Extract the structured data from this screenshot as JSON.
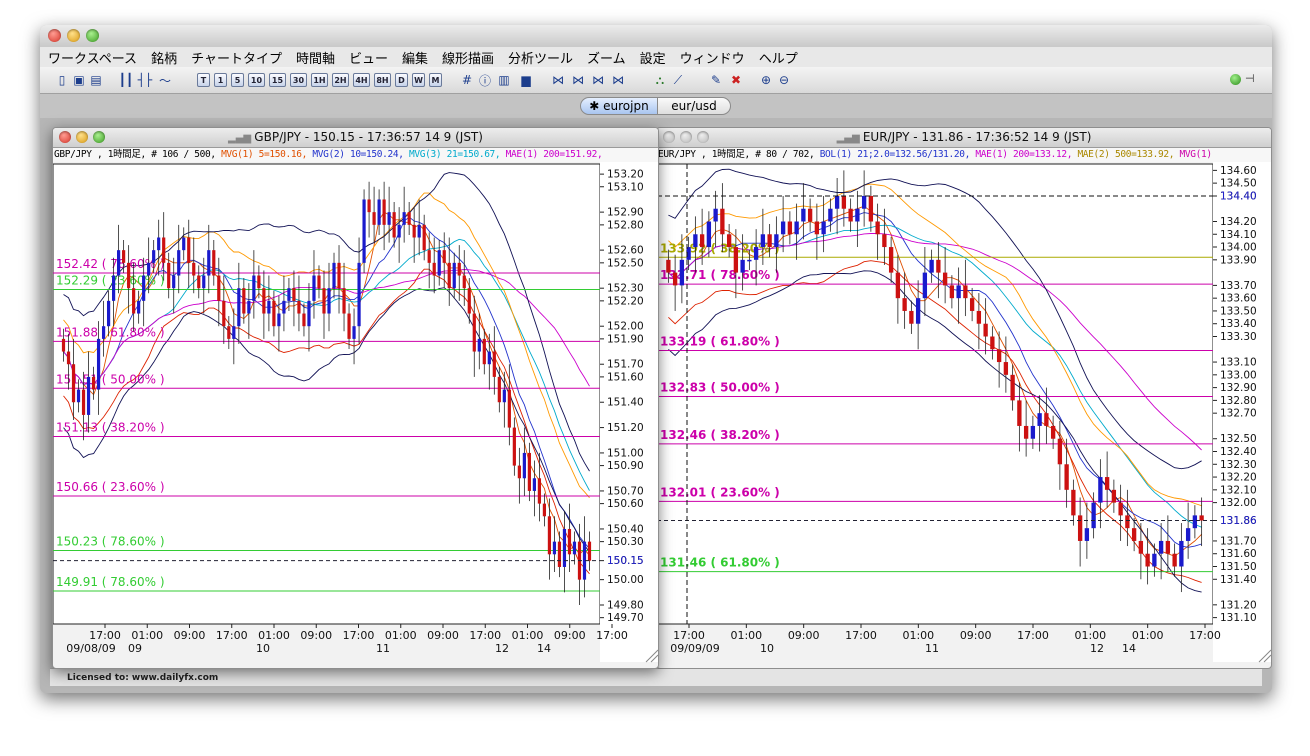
{
  "app": {
    "menus": [
      "ワークスペース",
      "銘柄",
      "チャートタイプ",
      "時間軸",
      "ビュー",
      "編集",
      "線形描画",
      "分析ツール",
      "ズーム",
      "設定",
      "ウィンドウ",
      "ヘルプ"
    ],
    "toolbar_timeframes": [
      "T",
      "1",
      "5",
      "10",
      "15",
      "30",
      "1H",
      "2H",
      "4H",
      "8H",
      "D",
      "W",
      "M"
    ],
    "toolbar_icons": [
      "new-chart-icon",
      "save-icon",
      "print-icon",
      "candle-chart-icon",
      "bar-chart-icon",
      "line-chart-icon",
      "grid-icon",
      "info-icon",
      "volume-icon",
      "bars-inactive-icon",
      "draw-tool-1-icon",
      "draw-tool-2-icon",
      "draw-tool-3-icon",
      "draw-tool-4-icon",
      "indicator-icon",
      "trend-line-icon",
      "eraser-icon",
      "delete-icon",
      "zoom-in-icon",
      "zoom-out-icon"
    ],
    "tabs": [
      {
        "label": "✱ eurojpn",
        "active": true
      },
      {
        "label": "eur/usd",
        "active": false
      }
    ],
    "status_text": "Licensed to: www.dailyfx.com",
    "colors": {
      "candle_up": "#1a1acc",
      "candle_down": "#cc1111",
      "fib": "#cc00aa",
      "fib_green": "#33cc33",
      "price_marker": "#2222cc"
    }
  },
  "charts": [
    {
      "title": "GBP/JPY - 150.15 - 17:36:57  14 9 (JST)",
      "info": [
        {
          "text": "GBP/JPY , 1時間足, # 106 / 500, ",
          "color": "#000000"
        },
        {
          "text": "MVG(1) 5=150.16, ",
          "color": "#e05000"
        },
        {
          "text": "MVG(2) 10=150.24, ",
          "color": "#2233cc"
        },
        {
          "text": "MVG(3) 21=150.67, ",
          "color": "#00aacc"
        },
        {
          "text": "MAE(1) 200=151.92, ",
          "color": "#cc00cc"
        }
      ],
      "fib_labels": [
        "152.42 ( 78.60% )",
        "152.29 ( 23.60% )",
        "151.88 ( 61.80% )",
        "151.51 ( 50.00% )",
        "151.13 ( 38.20% )",
        "150.66 ( 23.60% )",
        "150.23 ( 78.60% )",
        "149.91 ( 78.60% )"
      ],
      "current_price": "150.15",
      "xtick_times": [
        "17:00",
        "01:00",
        "09:00",
        "17:00",
        "01:00",
        "09:00",
        "17:00",
        "01:00",
        "09:00",
        "17:00",
        "01:00",
        "09:00",
        "17:00"
      ],
      "xtick_dates": [
        "09/08/09",
        "09",
        "10",
        "11",
        "12",
        "14"
      ],
      "chart_data": {
        "type": "candlestick",
        "y_ticks": [
          153.2,
          153.1,
          152.9,
          152.8,
          152.6,
          152.5,
          152.3,
          152.2,
          152.0,
          151.9,
          151.7,
          151.6,
          151.4,
          151.2,
          151.0,
          150.9,
          150.7,
          150.6,
          150.4,
          150.3,
          150.15,
          150.0,
          149.8,
          149.7
        ],
        "ylim": [
          149.65,
          153.28
        ],
        "fib_levels": [
          {
            "value": 152.42,
            "color": "#cc00aa"
          },
          {
            "value": 152.29,
            "color": "#33cc33"
          },
          {
            "value": 151.88,
            "color": "#cc00aa"
          },
          {
            "value": 151.51,
            "color": "#cc00aa"
          },
          {
            "value": 151.13,
            "color": "#cc00aa"
          },
          {
            "value": 150.66,
            "color": "#cc00aa"
          },
          {
            "value": 150.23,
            "color": "#33cc33"
          },
          {
            "value": 149.91,
            "color": "#33cc33"
          }
        ],
        "current_price": 150.15,
        "closes": [
          151.8,
          151.7,
          151.4,
          151.5,
          151.3,
          151.6,
          151.5,
          151.9,
          152.0,
          152.2,
          152.4,
          152.6,
          152.5,
          152.3,
          152.1,
          152.2,
          152.4,
          152.5,
          152.6,
          152.7,
          152.5,
          152.3,
          152.4,
          152.6,
          152.7,
          152.5,
          152.4,
          152.3,
          152.4,
          152.6,
          152.4,
          152.2,
          152.0,
          151.9,
          152.0,
          152.3,
          152.1,
          152.2,
          152.4,
          152.3,
          152.1,
          152.2,
          152.0,
          152.1,
          152.2,
          152.3,
          152.2,
          152.1,
          152.0,
          152.2,
          152.4,
          152.3,
          152.1,
          152.3,
          152.5,
          152.3,
          152.1,
          151.9,
          152.0,
          152.5,
          153.0,
          152.9,
          152.8,
          153.0,
          152.8,
          152.9,
          152.7,
          152.8,
          152.9,
          152.8,
          152.7,
          152.8,
          152.6,
          152.5,
          152.4,
          152.6,
          152.5,
          152.3,
          152.5,
          152.4,
          152.3,
          152.1,
          151.8,
          151.9,
          151.7,
          151.8,
          151.6,
          151.4,
          151.5,
          151.2,
          150.9,
          150.8,
          151.0,
          150.7,
          150.8,
          150.6,
          150.5,
          150.2,
          150.3,
          150.1,
          150.4,
          150.2,
          150.3,
          150.0,
          150.3,
          150.15
        ],
        "series": [
          {
            "name": "MVG(1) 5",
            "color": "#e05000"
          },
          {
            "name": "MVG(2) 10",
            "color": "#2233cc"
          },
          {
            "name": "MVG(3) 21",
            "color": "#00aacc"
          },
          {
            "name": "MAE(1) 200",
            "color": "#cc00cc"
          }
        ]
      }
    },
    {
      "title": "EUR/JPY - 131.86 - 17:36:52  14 9 (JST)",
      "info": [
        {
          "text": "EUR/JPY , 1時間足, # 80 / 702, ",
          "color": "#000000"
        },
        {
          "text": "BOL(1) 21;2.0=132.56/131.20, ",
          "color": "#2233cc"
        },
        {
          "text": "MAE(1) 200=133.12, ",
          "color": "#cc00cc"
        },
        {
          "text": "MAE(2) 500=133.92, ",
          "color": "#aa8800"
        },
        {
          "text": "MVG(1)",
          "color": "#cc00aa"
        }
      ],
      "fib_labels": [
        "133.92 ( 38.20% )",
        "133.71 ( 78.60% )",
        "133.19 ( 61.80% )",
        "132.83 ( 50.00% )",
        "132.46 ( 38.20% )",
        "132.01 ( 23.60% )",
        "131.46 ( 61.80% )"
      ],
      "current_price": "131.86",
      "crosshair_price": "134.40",
      "xtick_times": [
        "17:00",
        "01:00",
        "09:00",
        "17:00",
        "01:00",
        "09:00",
        "17:00",
        "01:00",
        "01:00",
        "17:00"
      ],
      "xtick_dates": [
        "09/09/09",
        "10",
        "11",
        "12",
        "14"
      ],
      "chart_data": {
        "type": "candlestick",
        "y_ticks": [
          134.6,
          134.5,
          134.4,
          134.2,
          134.1,
          134.0,
          133.9,
          133.7,
          133.6,
          133.5,
          133.4,
          133.3,
          133.1,
          133.0,
          132.9,
          132.8,
          132.7,
          132.5,
          132.4,
          132.3,
          132.2,
          132.1,
          132.0,
          131.86,
          131.7,
          131.6,
          131.5,
          131.4,
          131.2,
          131.1
        ],
        "ylim": [
          131.05,
          134.65
        ],
        "fib_levels": [
          {
            "value": 133.92,
            "color": "#aaaa00"
          },
          {
            "value": 133.71,
            "color": "#cc00aa"
          },
          {
            "value": 133.19,
            "color": "#cc00aa"
          },
          {
            "value": 132.83,
            "color": "#cc00aa"
          },
          {
            "value": 132.46,
            "color": "#cc00aa"
          },
          {
            "value": 132.01,
            "color": "#cc00aa"
          },
          {
            "value": 131.46,
            "color": "#33cc33"
          }
        ],
        "current_price": 131.86,
        "crosshair_price": 134.4,
        "closes": [
          133.8,
          133.7,
          133.9,
          134.0,
          134.1,
          134.0,
          134.2,
          134.3,
          134.1,
          134.0,
          133.8,
          133.9,
          133.9,
          134.0,
          134.1,
          134.0,
          134.1,
          134.2,
          134.1,
          134.2,
          134.3,
          134.2,
          134.1,
          134.2,
          134.3,
          134.4,
          134.3,
          134.2,
          134.3,
          134.4,
          134.2,
          134.1,
          134.0,
          133.8,
          133.6,
          133.5,
          133.4,
          133.6,
          133.8,
          133.9,
          133.8,
          133.7,
          133.6,
          133.7,
          133.6,
          133.5,
          133.4,
          133.3,
          133.2,
          133.1,
          133.0,
          132.8,
          132.6,
          132.5,
          132.6,
          132.7,
          132.6,
          132.5,
          132.3,
          132.1,
          131.9,
          131.7,
          131.8,
          132.0,
          132.2,
          132.1,
          132.0,
          131.9,
          131.8,
          131.7,
          131.6,
          131.5,
          131.6,
          131.7,
          131.6,
          131.5,
          131.7,
          131.8,
          131.9,
          131.86
        ],
        "series": [
          {
            "name": "BOL(1) 21;2.0",
            "color": "#2233cc"
          },
          {
            "name": "MAE(1) 200",
            "color": "#cc00cc"
          },
          {
            "name": "MAE(2) 500",
            "color": "#aa8800"
          }
        ]
      }
    }
  ]
}
